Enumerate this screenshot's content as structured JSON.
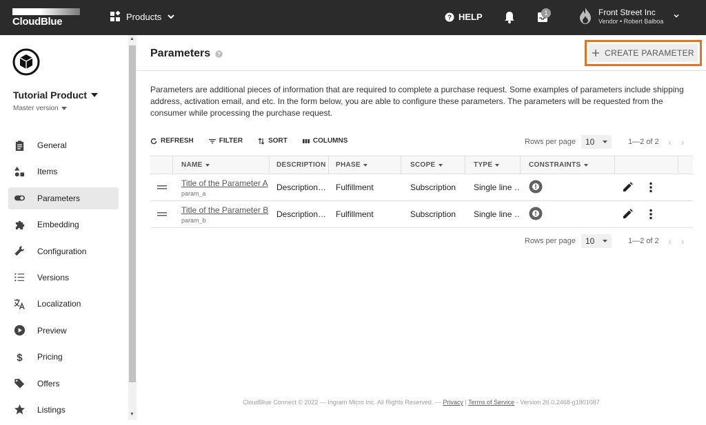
{
  "topbar": {
    "logo_text": "CloudBlue",
    "products_label": "Products",
    "help_label": "HELP",
    "inbox_count": "1",
    "account_name": "Front Street Inc",
    "account_sub": "Vendor • Robert Balboa"
  },
  "product": {
    "title": "Tutorial Product",
    "version": "Master version"
  },
  "nav": [
    {
      "label": "General",
      "icon": "clipboard-icon"
    },
    {
      "label": "Items",
      "icon": "shapes-icon"
    },
    {
      "label": "Parameters",
      "icon": "toggle-icon",
      "active": true
    },
    {
      "label": "Embedding",
      "icon": "puzzle-icon"
    },
    {
      "label": "Configuration",
      "icon": "wrench-icon"
    },
    {
      "label": "Versions",
      "icon": "list-icon"
    },
    {
      "label": "Localization",
      "icon": "translate-icon"
    },
    {
      "label": "Preview",
      "icon": "play-icon"
    },
    {
      "label": "Pricing",
      "icon": "dollar-icon"
    },
    {
      "label": "Offers",
      "icon": "tag-icon"
    },
    {
      "label": "Listings",
      "icon": "star-icon"
    }
  ],
  "main": {
    "title": "Parameters",
    "create_label": "CREATE PARAMETER",
    "description": "Parameters are additional pieces of information that are required to complete a purchase request. Some examples of parameters include shipping address, activation email, and etc. In the form below, you are able to configure these parameters. The parameters will be requested from the consumer while processing the purchase request."
  },
  "toolbar": {
    "refresh": "REFRESH",
    "filter": "FILTER",
    "sort": "SORT",
    "columns": "COLUMNS"
  },
  "pagination": {
    "rows_label": "Rows per page",
    "rows_value": "10",
    "range": "1—2 of 2"
  },
  "table": {
    "headers": {
      "name": "NAME",
      "description": "DESCRIPTION",
      "phase": "PHASE",
      "scope": "SCOPE",
      "type": "TYPE",
      "constraints": "CONSTRAINTS"
    },
    "rows": [
      {
        "title": "Title of the Parameter A",
        "id": "param_a",
        "description": "Description…",
        "phase": "Fulfillment",
        "scope": "Subscription",
        "type": "Single line …"
      },
      {
        "title": "Title of the Parameter B",
        "id": "param_b",
        "description": "Description…",
        "phase": "Fulfillment",
        "scope": "Subscription",
        "type": "Single line …"
      }
    ]
  },
  "footer": {
    "text": "CloudBlue Connect © 2022 — Ingram Micro Inc. All Rights Reserved. —",
    "privacy": "Privacy",
    "sep": "|",
    "terms": "Terms of Service",
    "version": "- Version 26.0.2468-g1801087"
  },
  "colors": {
    "topbar": "#2b2b2b",
    "highlight": "#e8731a"
  }
}
